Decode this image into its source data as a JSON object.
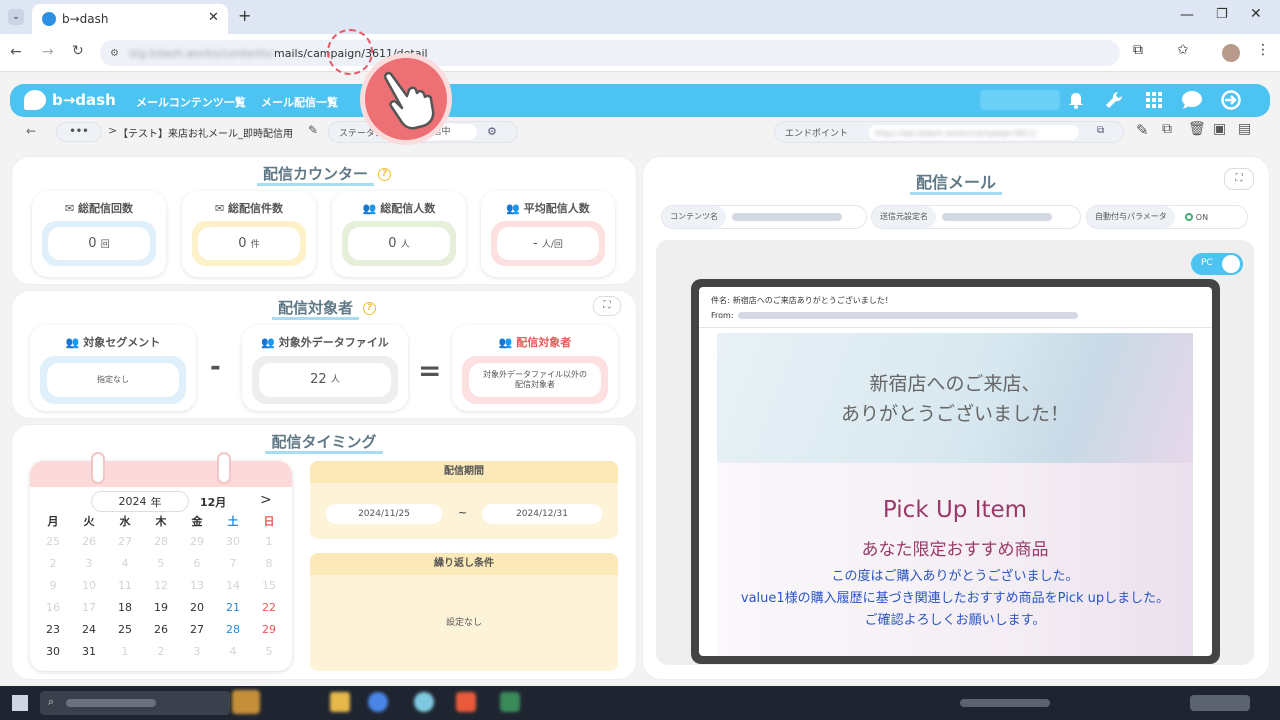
{
  "browser": {
    "tab_title": "b→dash",
    "url_visible": "mails/campaign/3611/detail",
    "url_blurred": "stg.bdash.works/contents/"
  },
  "app": {
    "logo": "b→dash",
    "nav": [
      "メールコンテンツ一覧",
      "メール配信一覧"
    ],
    "icons": [
      "bell-icon",
      "wrench-icon",
      "grid-icon",
      "chat-icon",
      "logout-icon"
    ]
  },
  "subbar": {
    "more": "•••",
    "breadcrumb_sep": ">",
    "campaign_name": "【テスト】来店お礼メール_即時配信用",
    "status_label": "ステータス",
    "status_value": "配信中",
    "endpoint_label": "エンドポイント",
    "endpoint_value": "https://api.bdash.works/campaign/3611/"
  },
  "counter": {
    "title": "配信カウンター",
    "help": "?",
    "stats": [
      {
        "label": "総配信回数",
        "num": "0",
        "unit": "回",
        "icon": "mail-icon"
      },
      {
        "label": "総配信件数",
        "num": "0",
        "unit": "件",
        "icon": "mail-icon"
      },
      {
        "label": "総配信人数",
        "num": "0",
        "unit": "人",
        "icon": "users-icon"
      },
      {
        "label": "平均配信人数",
        "num": "-",
        "unit": "人/回",
        "icon": "users-icon"
      }
    ]
  },
  "target": {
    "title": "配信対象者",
    "help": "?",
    "segment_label": "対象セグメント",
    "segment_value": "指定なし",
    "minus": "-",
    "exclude_label": "対象外データファイル",
    "exclude_num": "22",
    "exclude_unit": "人",
    "equals": "=",
    "result_label": "配信対象者",
    "result_value_line1": "対象外データファイル以外の",
    "result_value_line2": "配信対象者"
  },
  "timing": {
    "title": "配信タイミング",
    "year": "2024",
    "year_unit": "年",
    "month": "12月",
    "next": ">",
    "weekdays": [
      "月",
      "火",
      "水",
      "木",
      "金",
      "土",
      "日"
    ],
    "weeks": [
      [
        {
          "d": "25",
          "m": "dim"
        },
        {
          "d": "26",
          "m": "dim"
        },
        {
          "d": "27",
          "m": "dim"
        },
        {
          "d": "28",
          "m": "dim"
        },
        {
          "d": "29",
          "m": "dim"
        },
        {
          "d": "30",
          "m": "dim"
        },
        {
          "d": "1",
          "m": "dim"
        }
      ],
      [
        {
          "d": "2",
          "m": "dim"
        },
        {
          "d": "3",
          "m": "dim"
        },
        {
          "d": "4",
          "m": "dim"
        },
        {
          "d": "5",
          "m": "dim"
        },
        {
          "d": "6",
          "m": "dim"
        },
        {
          "d": "7",
          "m": "dim"
        },
        {
          "d": "8",
          "m": "dim"
        }
      ],
      [
        {
          "d": "9",
          "m": "dim"
        },
        {
          "d": "10",
          "m": "dim"
        },
        {
          "d": "11",
          "m": "dim"
        },
        {
          "d": "12",
          "m": "dim"
        },
        {
          "d": "13",
          "m": "dim"
        },
        {
          "d": "14",
          "m": "dim"
        },
        {
          "d": "15",
          "m": "dim"
        }
      ],
      [
        {
          "d": "16",
          "m": "dim"
        },
        {
          "d": "17",
          "m": "dim"
        },
        {
          "d": "18",
          "m": ""
        },
        {
          "d": "19",
          "m": ""
        },
        {
          "d": "20",
          "m": ""
        },
        {
          "d": "21",
          "m": "sat"
        },
        {
          "d": "22",
          "m": "sun"
        }
      ],
      [
        {
          "d": "23",
          "m": ""
        },
        {
          "d": "24",
          "m": ""
        },
        {
          "d": "25",
          "m": ""
        },
        {
          "d": "26",
          "m": ""
        },
        {
          "d": "27",
          "m": ""
        },
        {
          "d": "28",
          "m": "sat"
        },
        {
          "d": "29",
          "m": "sun"
        }
      ],
      [
        {
          "d": "30",
          "m": ""
        },
        {
          "d": "31",
          "m": ""
        },
        {
          "d": "1",
          "m": "dim"
        },
        {
          "d": "2",
          "m": "dim"
        },
        {
          "d": "3",
          "m": "dim"
        },
        {
          "d": "4",
          "m": "dim"
        },
        {
          "d": "5",
          "m": "dim"
        }
      ]
    ],
    "period_label": "配信期間",
    "start": "2024/11/25",
    "tilde": "~",
    "end": "2024/12/31",
    "repeat_label": "繰り返し条件",
    "repeat_value": "設定なし"
  },
  "mail": {
    "title": "配信メール",
    "content_label": "コンテンツ名",
    "sender_label": "送信元設定名",
    "auto_label": "自動付与パラメータ",
    "auto_value": "ON",
    "device_toggle": "PC",
    "subject_label": "件名:",
    "subject": "新宿店へのご来店ありがとうございました！",
    "from_label": "From:",
    "hero_line1": "新宿店へのご来店、",
    "hero_line2": "ありがとうございました！",
    "pickup": "Pick Up Item",
    "recommend": "あなた限定おすすめ商品",
    "body1": "この度はご購入ありがとうございました。",
    "body2": "value1様の購入履歴に基づき関連したおすすめ商品をPick upしました。",
    "body3": "ご確認よろしくお願いします。"
  },
  "colors": {
    "appbar": "#4dc3f2",
    "blue_box": "#dff0fb",
    "yellow_box": "#fdf1c9",
    "green_box": "#e6efd9",
    "red_box": "#fde0e0",
    "accent_red": "#e85a5a",
    "pickup_color": "#9a3a6a",
    "body_blue": "#2a55c4"
  }
}
